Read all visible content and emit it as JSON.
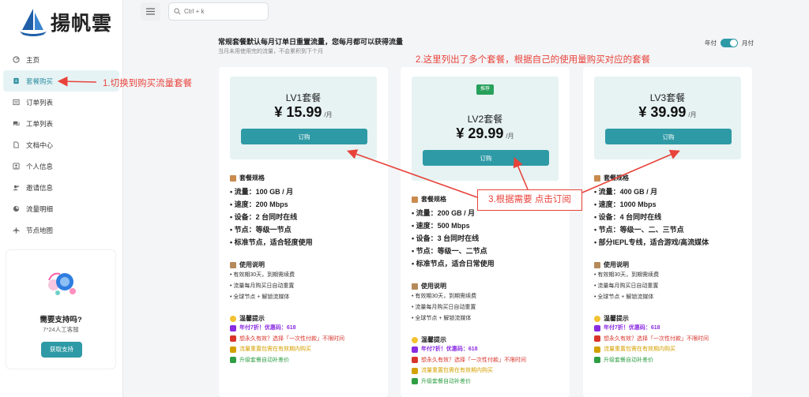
{
  "brand": {
    "name": "揚帆雲",
    "accent": "#2e9aa6",
    "annotation_color": "#e8433b"
  },
  "topbar": {
    "search_placeholder": "Ctrl + k"
  },
  "sidebar": {
    "items": [
      {
        "label": "主页",
        "icon": "dashboard-icon"
      },
      {
        "label": "套餐购买",
        "icon": "shop-icon",
        "active": true
      },
      {
        "label": "订单列表",
        "icon": "order-icon"
      },
      {
        "label": "工单列表",
        "icon": "ticket-icon"
      },
      {
        "label": "文档中心",
        "icon": "doc-icon"
      },
      {
        "label": "个人信息",
        "icon": "user-icon"
      },
      {
        "label": "邀请信息",
        "icon": "invite-icon"
      },
      {
        "label": "流量明细",
        "icon": "traffic-icon"
      },
      {
        "label": "节点地图",
        "icon": "plane-icon"
      }
    ],
    "support": {
      "title": "需要支持吗?",
      "subtitle": "7*24人工客服",
      "button": "获取支持"
    }
  },
  "notice": {
    "title": "常规套餐默认每月订单日重置流量，您每月都可以获得流量",
    "subtitle": "当月未用使用完的流量，不会累积到下个月"
  },
  "billing_toggle": {
    "left": "年付",
    "right": "月付",
    "selected": "月付"
  },
  "plans": [
    {
      "name": "LV1套餐",
      "price": "¥ 15.99",
      "unit": "/月",
      "badge": "",
      "buy": "订购",
      "spec_title": "套餐规格",
      "specs": [
        "• 流量：100 GB / 月",
        "• 速度：200 Mbps",
        "• 设备：2 台同时在线",
        "• 节点：等级一节点",
        "• 标准节点，适合轻度使用"
      ],
      "usage_title": "使用说明",
      "usage": [
        "• 有效期30天，到期需续费",
        "• 流量每月购买日自动重置",
        "• 全球节点 + 解锁流媒体"
      ],
      "tips_title": "温馨提示",
      "tips": [
        "年付7折！优惠码：618",
        "想永久有效？选择「一次性付款」不限时间",
        "流量重置包需在有效期内购买",
        "升级套餐自动补差价"
      ]
    },
    {
      "name": "LV2套餐",
      "price": "¥ 29.99",
      "unit": "/月",
      "badge": "推荐",
      "buy": "订购",
      "spec_title": "套餐规格",
      "specs": [
        "• 流量：200 GB / 月",
        "• 速度：500 Mbps",
        "• 设备：3 台同时在线",
        "• 节点：等级一、二节点",
        "• 标准节点，适合日常使用"
      ],
      "usage_title": "使用说明",
      "usage": [
        "• 有效期30天，到期需续费",
        "• 流量每月购买日自动重置",
        "• 全球节点 + 解锁流媒体"
      ],
      "tips_title": "温馨提示",
      "tips": [
        "年付7折！优惠码：618",
        "想永久有效？选择「一次性付款」不限时间",
        "流量重置包需在有效期内购买",
        "升级套餐自动补差价"
      ]
    },
    {
      "name": "LV3套餐",
      "price": "¥ 39.99",
      "unit": "/月",
      "badge": "",
      "buy": "订购",
      "spec_title": "套餐规格",
      "specs": [
        "• 流量：400 GB / 月",
        "• 速度：1000 Mbps",
        "• 设备：4 台同时在线",
        "• 节点：等级一、二、三节点",
        "• 部分IEPL专线，适合游戏/高流媒体"
      ],
      "usage_title": "使用说明",
      "usage": [
        "• 有效期30天，到期需续费",
        "• 流量每月购买日自动重置",
        "• 全球节点 + 解锁流媒体"
      ],
      "tips_title": "温馨提示",
      "tips": [
        "年付7折！优惠码：618",
        "想永久有效？选择「一次性付款」不限时间",
        "流量重置包需在有效期内购买",
        "升级套餐自动补差价"
      ]
    }
  ],
  "tip_colors": [
    "#8a2be2",
    "#d9342b",
    "#d4a000",
    "#2f9e44"
  ],
  "annotations": {
    "step1": "1.切换到购买流量套餐",
    "step2": "2.这里列出了多个套餐，根据自己的使用量购买对应的套餐",
    "step3": "3.根据需要 点击订阅"
  }
}
